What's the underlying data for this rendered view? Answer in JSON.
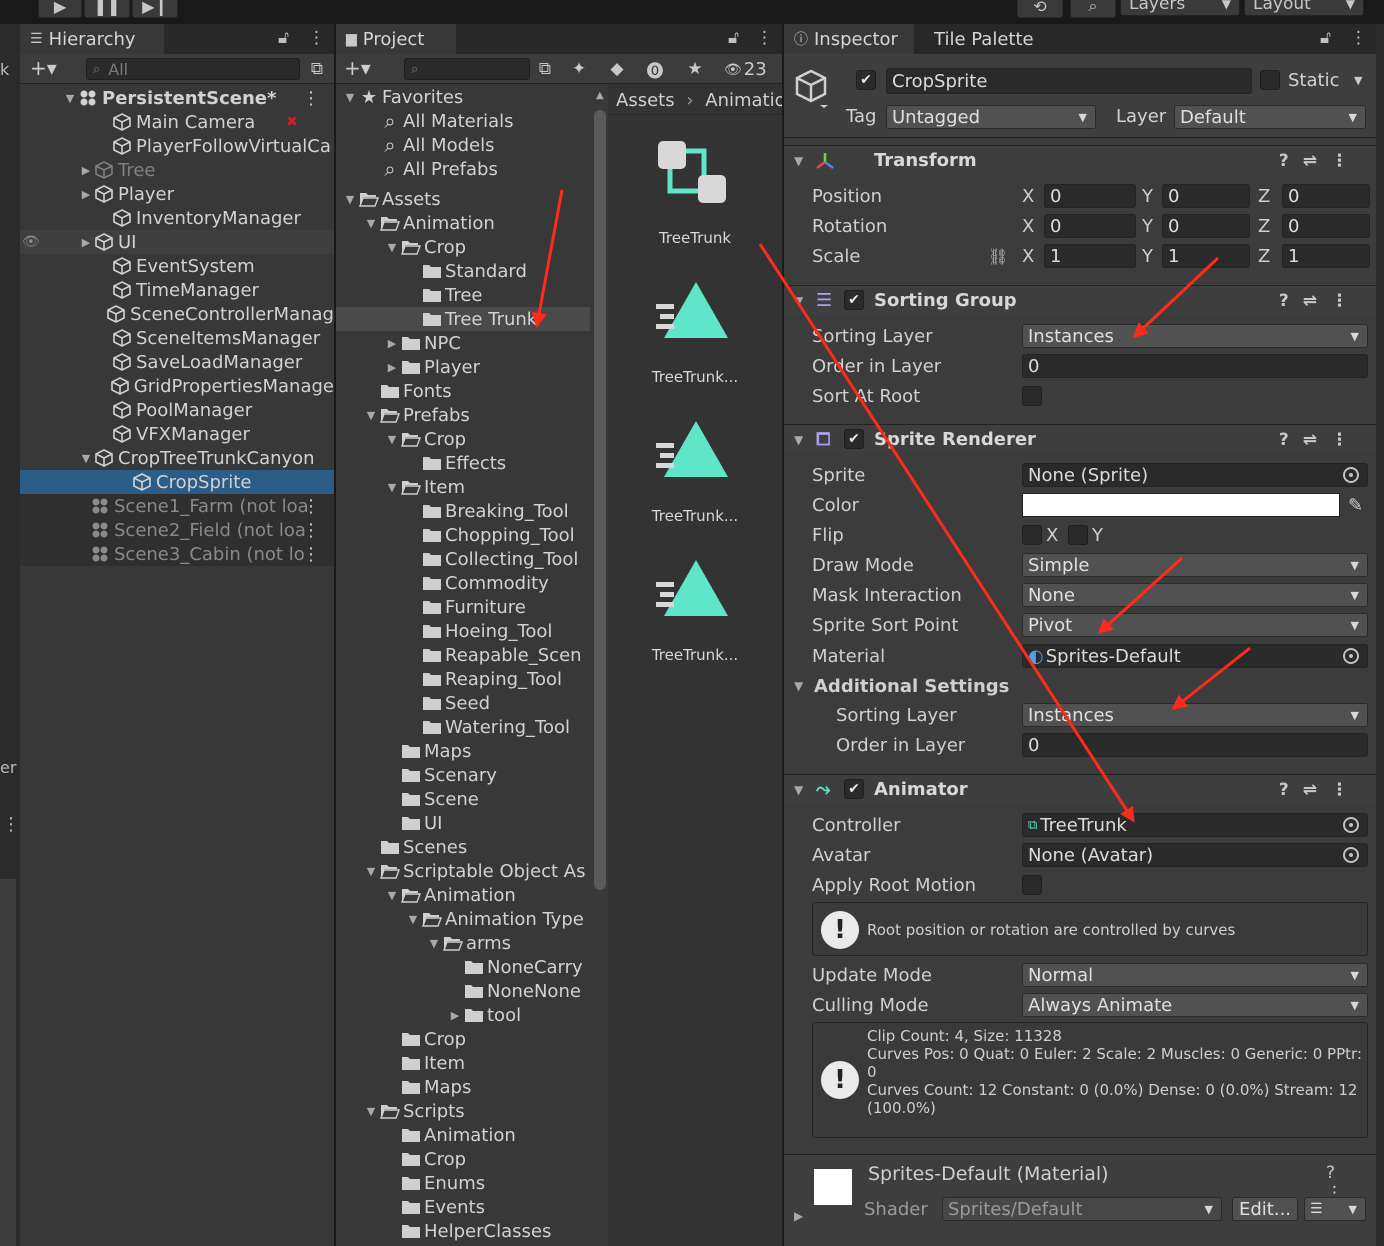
{
  "toolbar": {
    "layers_label": "Layers",
    "layout_label": "Layout"
  },
  "hierarchy": {
    "tab": "Hierarchy",
    "search_placeholder": "All",
    "items": [
      {
        "label": "PersistentScene*"
      },
      {
        "label": "Main Camera"
      },
      {
        "label": "PlayerFollowVirtualCa"
      },
      {
        "label": "Tree"
      },
      {
        "label": "Player"
      },
      {
        "label": "InventoryManager"
      },
      {
        "label": "UI"
      },
      {
        "label": "EventSystem"
      },
      {
        "label": "TimeManager"
      },
      {
        "label": "SceneControllerManag"
      },
      {
        "label": "SceneItemsManager"
      },
      {
        "label": "SaveLoadManager"
      },
      {
        "label": "GridPropertiesManage"
      },
      {
        "label": "PoolManager"
      },
      {
        "label": "VFXManager"
      },
      {
        "label": "CropTreeTrunkCanyon"
      },
      {
        "label": "CropSprite"
      },
      {
        "label": "Scene1_Farm (not loa"
      },
      {
        "label": "Scene2_Field (not loa"
      },
      {
        "label": "Scene3_Cabin (not lo"
      }
    ],
    "edge_labels": [
      "k",
      "er"
    ]
  },
  "project": {
    "tab": "Project",
    "hidden_count": "23",
    "breadcrumb": [
      "Assets",
      "Animation"
    ],
    "tree": [
      {
        "label": "Favorites"
      },
      {
        "label": "All Materials"
      },
      {
        "label": "All Models"
      },
      {
        "label": "All Prefabs"
      },
      {
        "label": "Assets"
      },
      {
        "label": "Animation"
      },
      {
        "label": "Crop"
      },
      {
        "label": "Standard"
      },
      {
        "label": "Tree"
      },
      {
        "label": "Tree Trunk"
      },
      {
        "label": "NPC"
      },
      {
        "label": "Player"
      },
      {
        "label": "Fonts"
      },
      {
        "label": "Prefabs"
      },
      {
        "label": "Crop"
      },
      {
        "label": "Effects"
      },
      {
        "label": "Item"
      },
      {
        "label": "Breaking_Tool"
      },
      {
        "label": "Chopping_Tool"
      },
      {
        "label": "Collecting_Tool"
      },
      {
        "label": "Commodity"
      },
      {
        "label": "Furniture"
      },
      {
        "label": "Hoeing_Tool"
      },
      {
        "label": "Reapable_Scen"
      },
      {
        "label": "Reaping_Tool"
      },
      {
        "label": "Seed"
      },
      {
        "label": "Watering_Tool"
      },
      {
        "label": "Maps"
      },
      {
        "label": "Scenary"
      },
      {
        "label": "Scene"
      },
      {
        "label": "UI"
      },
      {
        "label": "Scenes"
      },
      {
        "label": "Scriptable Object As"
      },
      {
        "label": "Animation"
      },
      {
        "label": "Animation Type"
      },
      {
        "label": "arms"
      },
      {
        "label": "NoneCarry"
      },
      {
        "label": "NoneNone"
      },
      {
        "label": "tool"
      },
      {
        "label": "Crop"
      },
      {
        "label": "Item"
      },
      {
        "label": "Maps"
      },
      {
        "label": "Scripts"
      },
      {
        "label": "Animation"
      },
      {
        "label": "Crop"
      },
      {
        "label": "Enums"
      },
      {
        "label": "Events"
      },
      {
        "label": "HelperClasses"
      }
    ],
    "assets": [
      {
        "label": "TreeTrunk",
        "kind": "animator-controller-icon"
      },
      {
        "label": "TreeTrunk...",
        "kind": "animation-clip-icon"
      },
      {
        "label": "TreeTrunk...",
        "kind": "animation-clip-icon"
      },
      {
        "label": "TreeTrunk...",
        "kind": "animation-clip-icon"
      }
    ]
  },
  "inspector": {
    "tabs": [
      "Inspector",
      "Tile Palette"
    ],
    "object_name": "CropSprite",
    "static_label": "Static",
    "tag_label": "Tag",
    "tag_value": "Untagged",
    "layer_label": "Layer",
    "layer_value": "Default",
    "transform": {
      "title": "Transform",
      "position_label": "Position",
      "rotation_label": "Rotation",
      "scale_label": "Scale",
      "position": {
        "x": "0",
        "y": "0",
        "z": "0"
      },
      "rotation": {
        "x": "0",
        "y": "0",
        "z": "0"
      },
      "scale": {
        "x": "1",
        "y": "1",
        "z": "1"
      },
      "axis_x": "X",
      "axis_y": "Y",
      "axis_z": "Z"
    },
    "sorting_group": {
      "title": "Sorting Group",
      "sorting_layer_label": "Sorting Layer",
      "sorting_layer": "Instances",
      "order_label": "Order in Layer",
      "order": "0",
      "sort_at_root_label": "Sort At Root"
    },
    "sprite_renderer": {
      "title": "Sprite Renderer",
      "sprite_label": "Sprite",
      "sprite": "None (Sprite)",
      "color_label": "Color",
      "color": "#ffffff",
      "flip_label": "Flip",
      "flip_x": "X",
      "flip_y": "Y",
      "draw_mode_label": "Draw Mode",
      "draw_mode": "Simple",
      "mask_label": "Mask Interaction",
      "mask": "None",
      "sort_point_label": "Sprite Sort Point",
      "sort_point": "Pivot",
      "material_label": "Material",
      "material": "Sprites-Default",
      "additional_label": "Additional Settings",
      "add_sorting_layer_label": "Sorting Layer",
      "add_sorting_layer": "Instances",
      "add_order_label": "Order in Layer",
      "add_order": "0"
    },
    "animator": {
      "title": "Animator",
      "controller_label": "Controller",
      "controller": "TreeTrunk",
      "avatar_label": "Avatar",
      "avatar": "None (Avatar)",
      "root_motion_label": "Apply Root Motion",
      "root_motion_info": "Root position or rotation are controlled by curves",
      "update_mode_label": "Update Mode",
      "update_mode": "Normal",
      "culling_mode_label": "Culling Mode",
      "culling_mode": "Always Animate",
      "clip_info": [
        "Clip Count: 4, Size: 11328",
        "Curves Pos: 0 Quat: 0 Euler: 2 Scale: 2 Muscles: 0 Generic: 0 PPtr:",
        "0",
        "Curves Count: 12 Constant: 0 (0.0%) Dense: 0 (0.0%) Stream: 12",
        "(100.0%)"
      ]
    },
    "material_preview": {
      "title": "Sprites-Default (Material)",
      "shader_label": "Shader",
      "shader": "Sprites/Default",
      "edit_label": "Edit..."
    }
  },
  "colors": {
    "selection": "#2c5d87",
    "teal": "#5fe6c8",
    "annotation_red": "#ff2a1a"
  }
}
